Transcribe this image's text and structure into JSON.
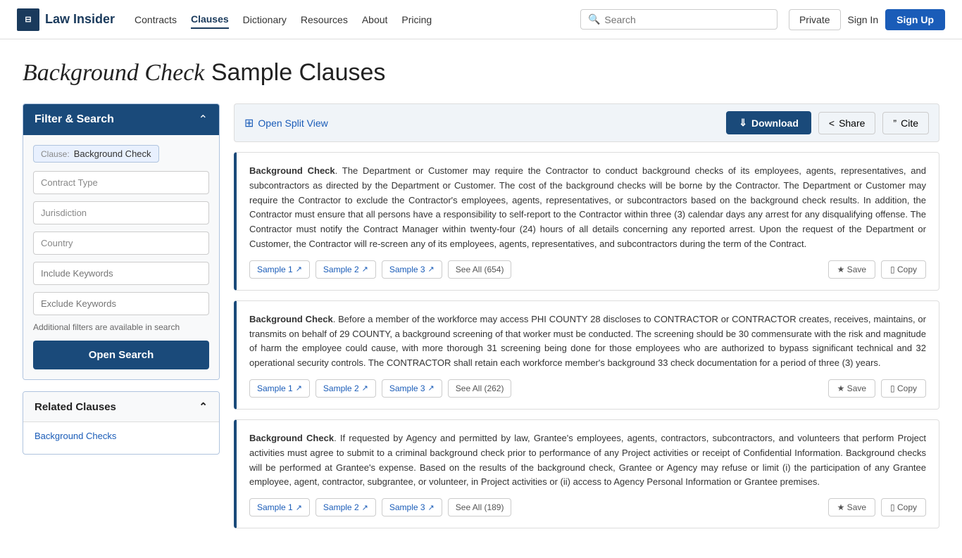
{
  "navbar": {
    "logo_icon": "⊟",
    "logo_text": "Law Insider",
    "nav_items": [
      {
        "label": "Contracts",
        "active": false
      },
      {
        "label": "Clauses",
        "active": true
      },
      {
        "label": "Dictionary",
        "active": false
      },
      {
        "label": "Resources",
        "active": false
      },
      {
        "label": "About",
        "active": false
      },
      {
        "label": "Pricing",
        "active": false
      }
    ],
    "search_placeholder": "Search",
    "btn_private": "Private",
    "btn_signin": "Sign In",
    "btn_signup": "Sign Up"
  },
  "page": {
    "title_italic": "Background Check",
    "title_normal": " Sample Clauses"
  },
  "sidebar": {
    "filter_title": "Filter & Search",
    "clause_tag_label": "Clause:",
    "clause_tag_value": "Background Check",
    "contract_type_placeholder": "Contract Type",
    "jurisdiction_placeholder": "Jurisdiction",
    "country_placeholder": "Country",
    "include_keywords_placeholder": "Include Keywords",
    "exclude_keywords_placeholder": "Exclude Keywords",
    "filter_note": "Additional filters are available in search",
    "open_search_label": "Open Search"
  },
  "related": {
    "title": "Related Clauses",
    "links": [
      "Background Checks"
    ]
  },
  "toolbar": {
    "split_view_label": "Open Split View",
    "download_label": "Download",
    "share_label": "Share",
    "cite_label": "Cite"
  },
  "clauses": [
    {
      "id": 1,
      "title": "Background Check",
      "text": ". The Department or Customer may require the Contractor to conduct background checks of its employees, agents, representatives, and subcontractors as directed by the Department or Customer. The cost of the background checks will be borne by the Contractor. The Department or Customer may require the Contractor to exclude the Contractor's employees, agents, representatives, or subcontractors based on the background check results. In addition, the Contractor must ensure that all persons have a responsibility to self-report to the Contractor within three (3) calendar days any arrest for any disqualifying offense. The Contractor must notify the Contract Manager within twenty-four (24) hours of all details concerning any reported arrest. Upon the request of the Department or Customer, the Contractor will re-screen any of its employees, agents, representatives, and subcontractors during the term of the Contract.",
      "samples": [
        "Sample 1",
        "Sample 2",
        "Sample 3"
      ],
      "see_all": "See All (654)"
    },
    {
      "id": 2,
      "title": "Background Check",
      "text": ". Before a member of the workforce may access PHI COUNTY 28 discloses to CONTRACTOR or CONTRACTOR creates, receives, maintains, or transmits on behalf of 29 COUNTY, a background screening of that worker must be conducted. The screening should be 30 commensurate with the risk and magnitude of harm the employee could cause, with more thorough 31 screening being done for those employees who are authorized to bypass significant technical and 32 operational security controls. The CONTRACTOR shall retain each workforce member's background 33 check documentation for a period of three (3) years.",
      "samples": [
        "Sample 1",
        "Sample 2",
        "Sample 3"
      ],
      "see_all": "See All (262)"
    },
    {
      "id": 3,
      "title": "Background Check",
      "text": ". If requested by Agency and permitted by law, Grantee's employees, agents, contractors, subcontractors, and volunteers that perform Project activities must agree to submit to a criminal background check prior to performance of any Project activities or receipt of Confidential Information. Background checks will be performed at Grantee's expense. Based on the results of the background check, Grantee or Agency may refuse or limit (i) the participation of any Grantee employee, agent, contractor, subgrantee, or volunteer, in Project activities or (ii) access to Agency Personal Information or Grantee premises.",
      "samples": [
        "Sample 1",
        "Sample 2",
        "Sample 3"
      ],
      "see_all": "See All (189)"
    }
  ]
}
